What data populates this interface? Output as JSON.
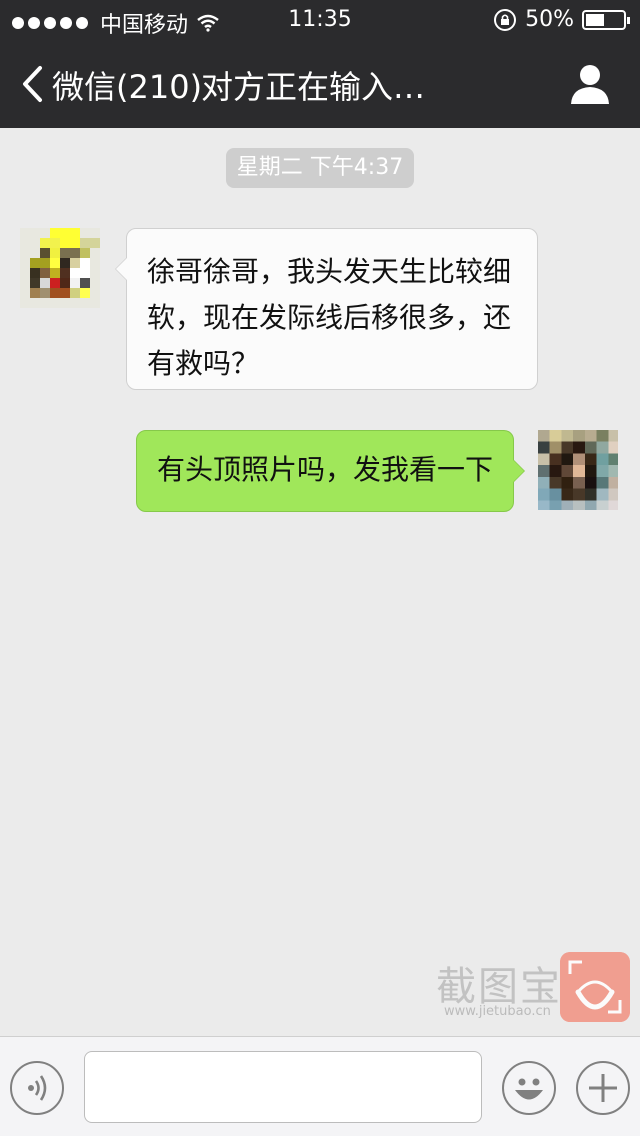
{
  "status_bar": {
    "carrier": "中国移动",
    "time": "11:35",
    "battery": "50%",
    "battery_level": 0.5,
    "signal_dots": 5
  },
  "nav": {
    "back_label": "微信(210)",
    "title": "对方正在输入…"
  },
  "chat": {
    "timestamp": "星期二 下午4:37",
    "messages": [
      {
        "direction": "incoming",
        "text": "徐哥徐哥，我头发天生比较细软，现在发际线后移很多，还有救吗？"
      },
      {
        "direction": "outgoing",
        "text": "有头顶照片吗，发我看一下"
      }
    ]
  },
  "watermark": {
    "text": "截图宝",
    "url": "www.jietubao.cn"
  },
  "input_bar": {
    "text_value": "",
    "icons": [
      "voice-icon",
      "emoji-icon",
      "plus-icon"
    ]
  },
  "colors": {
    "nav_bg": "#2b2b2d",
    "chat_bg": "#ebebeb",
    "incoming_bubble": "#fbfbfb",
    "outgoing_bubble": "#a0e75a"
  }
}
